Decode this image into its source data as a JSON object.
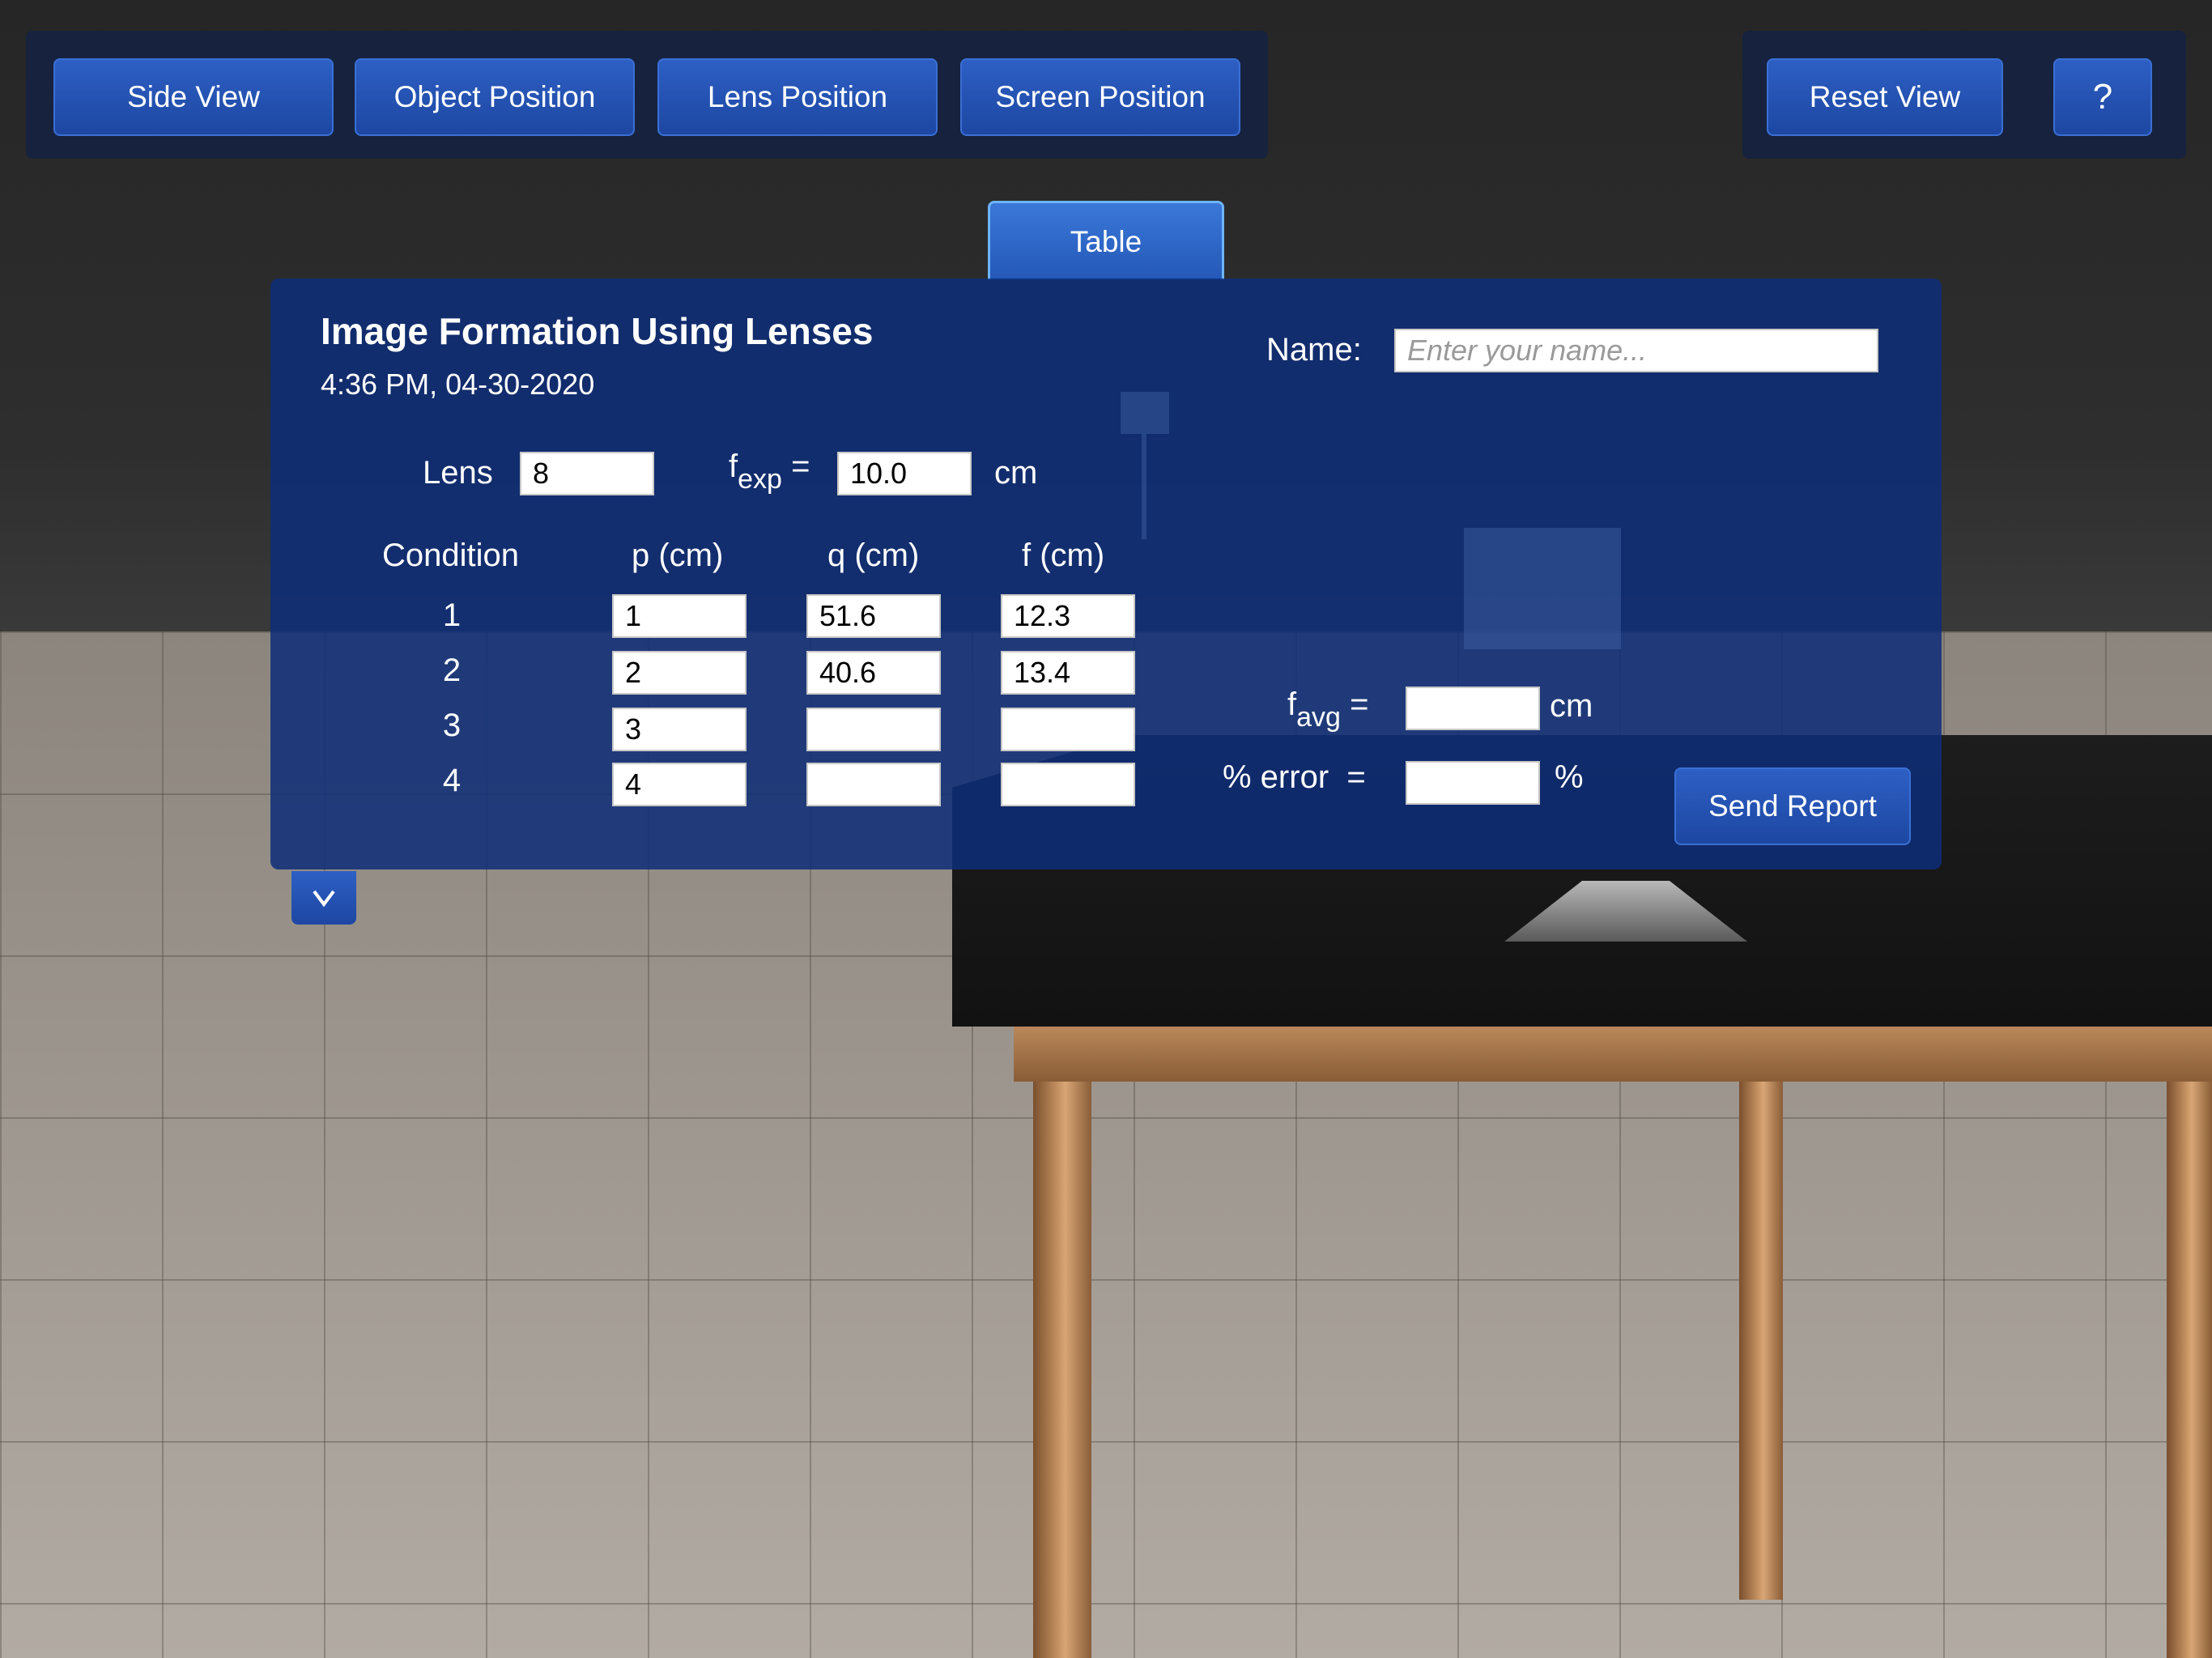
{
  "toolbar": {
    "buttons": [
      "Side View",
      "Object Position",
      "Lens Position",
      "Screen Position"
    ],
    "reset_label": "Reset View",
    "help_label": "?"
  },
  "tab": {
    "label": "Table"
  },
  "report": {
    "title": "Image Formation Using Lenses",
    "datetime": "4:36 PM, 04-30-2020",
    "name_label": "Name:",
    "name_value": "",
    "name_placeholder": "Enter your name...",
    "lens_label": "Lens",
    "lens_value": "8",
    "fexp_f": "f",
    "fexp_sub": "exp",
    "equals": "=",
    "fexp_value": "10.0",
    "unit_cm": "cm",
    "columns": [
      "Condition",
      "p (cm)",
      "q (cm)",
      "f (cm)"
    ],
    "rows": [
      {
        "condition": "1",
        "p": "1",
        "q": "51.6",
        "f": "12.3"
      },
      {
        "condition": "2",
        "p": "2",
        "q": "40.6",
        "f": "13.4"
      },
      {
        "condition": "3",
        "p": "3",
        "q": "",
        "f": ""
      },
      {
        "condition": "4",
        "p": "4",
        "q": "",
        "f": ""
      }
    ],
    "favg_f": "f",
    "favg_sub": "avg",
    "favg_value": "",
    "error_label": "% error",
    "error_value": "",
    "percent_unit": "%",
    "send_label": "Send Report"
  },
  "collapse_glyph": "v"
}
